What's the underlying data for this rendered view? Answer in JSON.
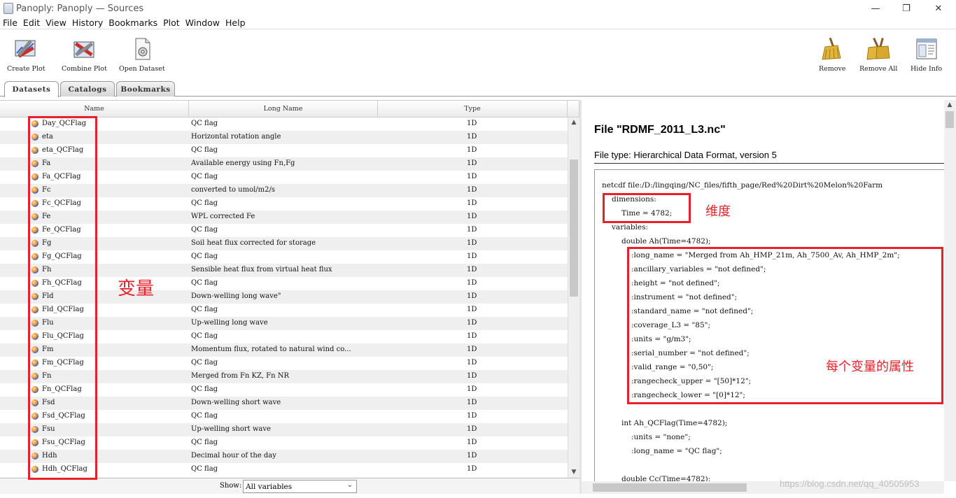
{
  "window": {
    "title": "Panoply: Panoply — Sources",
    "minimize": "—",
    "restore": "❐",
    "close": "✕"
  },
  "menu": [
    "File",
    "Edit",
    "View",
    "History",
    "Bookmarks",
    "Plot",
    "Window",
    "Help"
  ],
  "toolbar": {
    "create_plot": "Create Plot",
    "combine_plot": "Combine Plot",
    "open_dataset": "Open Dataset",
    "remove": "Remove",
    "remove_all": "Remove All",
    "hide_info": "Hide Info"
  },
  "tabs": [
    "Datasets",
    "Catalogs",
    "Bookmarks"
  ],
  "table": {
    "headers": [
      "Name",
      "Long Name",
      "Type"
    ],
    "rows": [
      {
        "name": "Day_QCFlag",
        "long": "QC flag",
        "type": "1D"
      },
      {
        "name": "eta",
        "long": "Horizontal rotation angle",
        "type": "1D"
      },
      {
        "name": "eta_QCFlag",
        "long": "QC flag",
        "type": "1D"
      },
      {
        "name": "Fa",
        "long": "Available energy using Fn,Fg",
        "type": "1D"
      },
      {
        "name": "Fa_QCFlag",
        "long": "QC flag",
        "type": "1D"
      },
      {
        "name": "Fc",
        "long": "converted to umol/m2/s",
        "type": "1D"
      },
      {
        "name": "Fc_QCFlag",
        "long": "QC flag",
        "type": "1D"
      },
      {
        "name": "Fe",
        "long": "WPL corrected Fe",
        "type": "1D"
      },
      {
        "name": "Fe_QCFlag",
        "long": "QC flag",
        "type": "1D"
      },
      {
        "name": "Fg",
        "long": "Soil heat flux corrected for storage",
        "type": "1D"
      },
      {
        "name": "Fg_QCFlag",
        "long": "QC flag",
        "type": "1D"
      },
      {
        "name": "Fh",
        "long": "Sensible heat flux from virtual heat flux",
        "type": "1D"
      },
      {
        "name": "Fh_QCFlag",
        "long": "QC flag",
        "type": "1D"
      },
      {
        "name": "Fld",
        "long": "Down-welling long wave\"",
        "type": "1D"
      },
      {
        "name": "Fld_QCFlag",
        "long": "QC flag",
        "type": "1D"
      },
      {
        "name": "Flu",
        "long": "Up-welling long wave",
        "type": "1D"
      },
      {
        "name": "Flu_QCFlag",
        "long": "QC flag",
        "type": "1D"
      },
      {
        "name": "Fm",
        "long": "Momentum flux, rotated to natural wind co...",
        "type": "1D"
      },
      {
        "name": "Fm_QCFlag",
        "long": "QC flag",
        "type": "1D"
      },
      {
        "name": "Fn",
        "long": "Merged from Fn KZ, Fn NR",
        "type": "1D"
      },
      {
        "name": "Fn_QCFlag",
        "long": "QC flag",
        "type": "1D"
      },
      {
        "name": "Fsd",
        "long": "Down-welling short wave",
        "type": "1D"
      },
      {
        "name": "Fsd_QCFlag",
        "long": "QC flag",
        "type": "1D"
      },
      {
        "name": "Fsu",
        "long": "Up-welling short wave",
        "type": "1D"
      },
      {
        "name": "Fsu_QCFlag",
        "long": "QC flag",
        "type": "1D"
      },
      {
        "name": "Hdh",
        "long": "Decimal hour of the day",
        "type": "1D"
      },
      {
        "name": "Hdh_QCFlag",
        "long": "QC flag",
        "type": "1D"
      }
    ]
  },
  "show": {
    "label": "Show:",
    "selected": "All variables"
  },
  "info": {
    "title": "File \"RDMF_2011_L3.nc\"",
    "file_type": "File type: Hierarchical Data Format, version 5",
    "lines": [
      "netcdf file:/D:/lingqing/NC_files/fifth_page/Red%20Dirt%20Melon%20Farm",
      "dimensions:",
      "Time = 4782;",
      "variables:",
      "double Ah(Time=4782);",
      ":long_name = \"Merged from Ah_HMP_21m, Ah_7500_Av, Ah_HMP_2m\";",
      ":ancillary_variables = \"not defined\";",
      ":height = \"not defined\";",
      ":instrument = \"not defined\";",
      ":standard_name = \"not defined\";",
      ":coverage_L3 = \"85\";",
      ":units = \"g/m3\";",
      ":serial_number = \"not defined\";",
      ":valid_range = \"0,50\";",
      ":rangecheck_upper = \"[50]*12\";",
      ":rangecheck_lower = \"[0]*12\";",
      "int Ah_QCFlag(Time=4782);",
      ":units = \"none\";",
      ":long_name = \"QC flag\";",
      "double Cc(Time=4782);"
    ]
  },
  "annotations": {
    "variables": "变量",
    "dimensions": "维度",
    "attributes": "每个变量的属性"
  },
  "watermark": "https://blog.csdn.net/qq_40505953",
  "colors": {
    "annotation_red": "#e8202a",
    "row_alt": "#efefef"
  }
}
